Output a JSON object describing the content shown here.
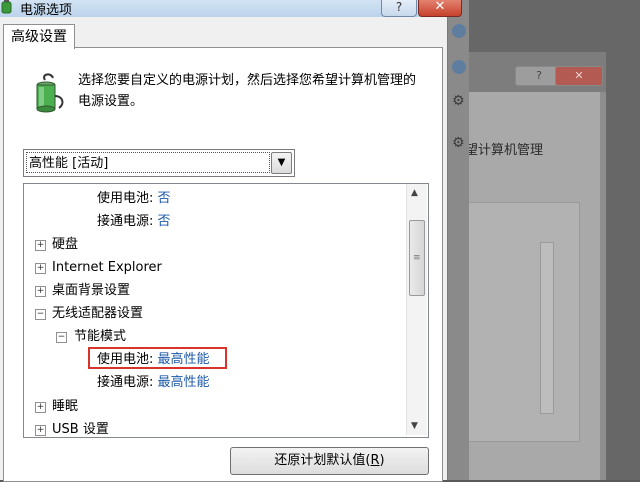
{
  "window": {
    "title": "电源选项",
    "help_label": "?",
    "close_label": "✕"
  },
  "tabs": [
    {
      "label": "高级设置",
      "active": true
    }
  ],
  "description": "选择您要自定义的电源计划，然后选择您希望计算机管理的电源设置。",
  "plan_select": {
    "value": "高性能 [活动]",
    "arrow": "▼"
  },
  "tree": [
    {
      "label": "使用电池:",
      "value": "否",
      "level": 2,
      "expander": ""
    },
    {
      "label": "接通电源:",
      "value": "否",
      "level": 2,
      "expander": ""
    },
    {
      "label": "硬盘",
      "value": "",
      "level": 0,
      "expander": "+"
    },
    {
      "label": "Internet Explorer",
      "value": "",
      "level": 0,
      "expander": "+"
    },
    {
      "label": "桌面背景设置",
      "value": "",
      "level": 0,
      "expander": "+"
    },
    {
      "label": "无线适配器设置",
      "value": "",
      "level": 0,
      "expander": "−"
    },
    {
      "label": "节能模式",
      "value": "",
      "level": 1,
      "expander": "−"
    },
    {
      "label": "使用电池:",
      "value": "最高性能",
      "level": 2,
      "expander": "",
      "highlighted": true
    },
    {
      "label": "接通电源:",
      "value": "最高性能",
      "level": 2,
      "expander": ""
    },
    {
      "label": "睡眠",
      "value": "",
      "level": 0,
      "expander": "+"
    },
    {
      "label": "USB 设置",
      "value": "",
      "level": 0,
      "expander": "+"
    }
  ],
  "scrollbar": {
    "up": "▲",
    "down": "▼",
    "grip": "≡"
  },
  "restore_button": {
    "label": "还原计划默认值",
    "accel": "R"
  },
  "background_window": {
    "text": "望计算机管理",
    "help_label": "?",
    "close_label": "✕"
  },
  "colors": {
    "value_blue": "#1e5aa8",
    "highlight_red": "#d9342b"
  }
}
